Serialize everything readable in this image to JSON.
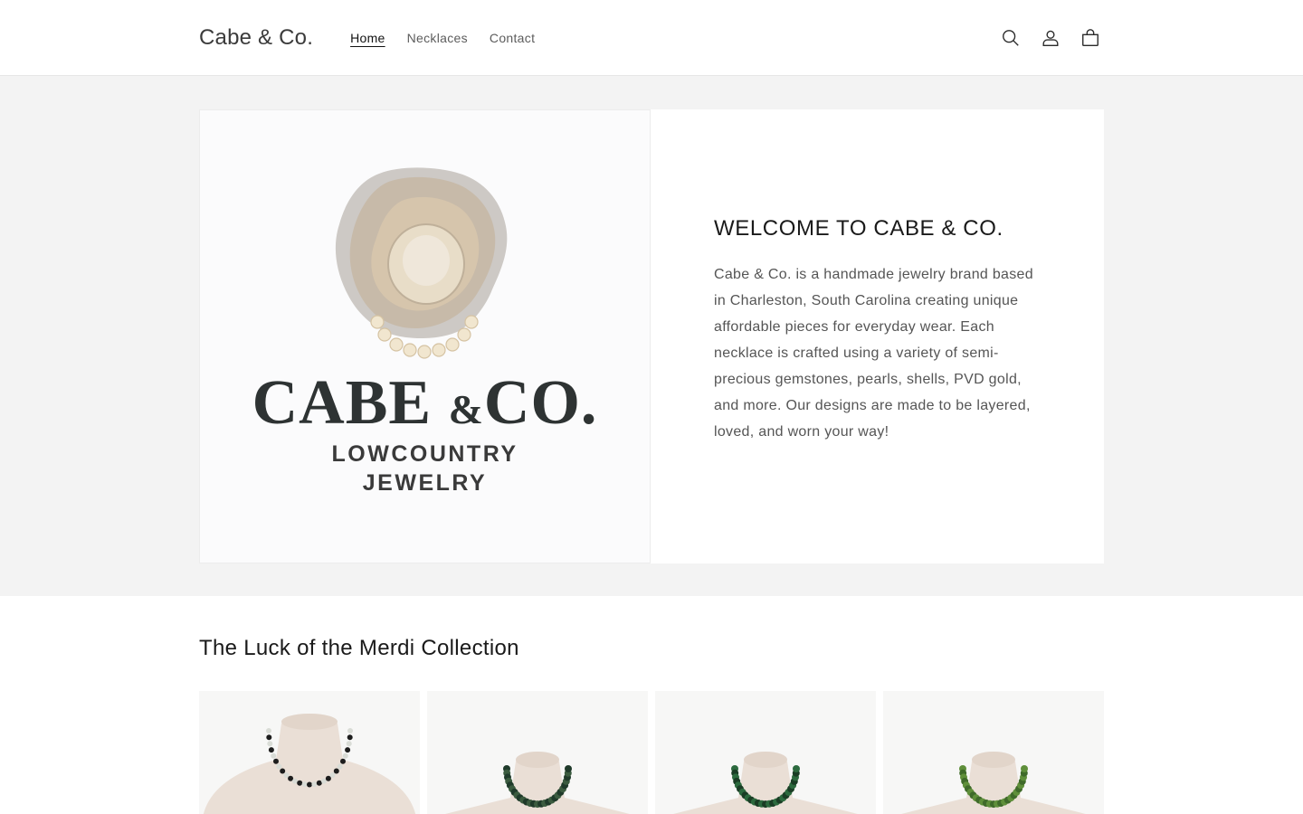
{
  "header": {
    "logo": "Cabe & Co.",
    "nav": [
      {
        "label": "Home",
        "active": true
      },
      {
        "label": "Necklaces",
        "active": false
      },
      {
        "label": "Contact",
        "active": false
      }
    ],
    "icons": [
      "search-icon",
      "account-icon",
      "cart-icon"
    ]
  },
  "hero": {
    "image": {
      "brand_name": "CABE & CO.",
      "brand_name_parts": [
        "CABE ",
        "&",
        "CO."
      ],
      "tagline_line1": "LOWCOUNTRY",
      "tagline_line2": "JEWELRY"
    },
    "heading": "WELCOME TO CABE & CO.",
    "body": "Cabe & Co. is a handmade jewelry brand based in Charleston, South Carolina creating unique affordable pieces for everyday wear. Each necklace is crafted using a variety of semi-precious gemstones, pearls, shells, PVD gold, and more. Our designs are made to be layered, loved, and worn your way!"
  },
  "collection": {
    "title": "The Luck of the Merdi Collection",
    "products": [
      {
        "bead_color": "#d9dcd6",
        "accent_color": "#1d1d1d"
      },
      {
        "bead_color": "#1f3a2a",
        "accent_color": "#3b5b3f"
      },
      {
        "bead_color": "#2c6a3e",
        "accent_color": "#1a3d25"
      },
      {
        "bead_color": "#5f8f3a",
        "accent_color": "#3f6a2a"
      }
    ]
  },
  "colors": {
    "band_background": "#f3f3f3",
    "text_primary": "#121212",
    "text_muted": "#555555"
  }
}
